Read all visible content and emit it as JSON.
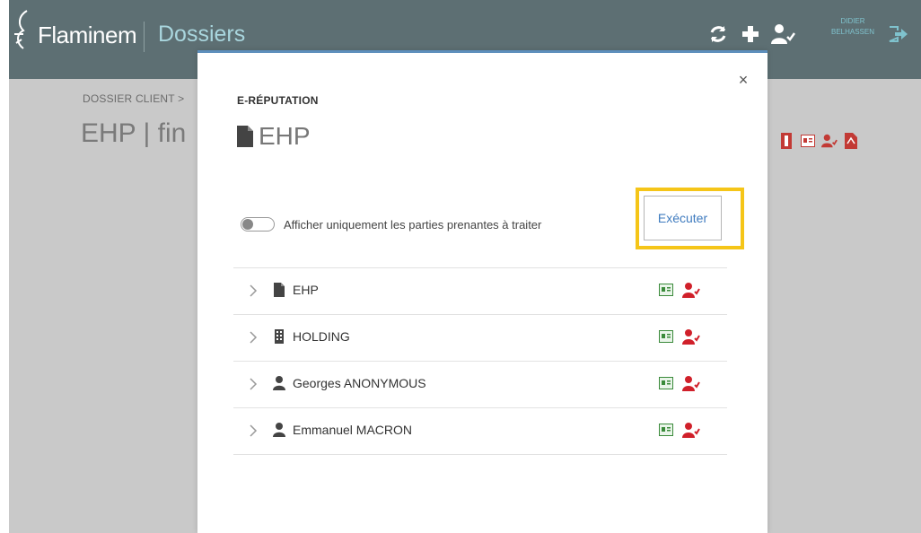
{
  "app": {
    "brand": "Flaminem",
    "module": "Dossiers",
    "user_line1": "DIDIER",
    "user_line2": "BELHASSEN",
    "colors": {
      "topbar": "#5d6f73",
      "accent": "#3f7bbf",
      "red": "#d0202a",
      "green": "#3a8a3a",
      "highlight": "#f5c518"
    }
  },
  "background": {
    "breadcrumb": "DOSSIER CLIENT  >  ",
    "title": "EHP | fin"
  },
  "modal": {
    "kicker": "E-RÉPUTATION",
    "title": "EHP",
    "close": "×",
    "toggle_label": "Afficher uniquement les parties prenantes à traiter",
    "execute": "Exécuter"
  },
  "entities": [
    {
      "label": "EHP",
      "icon": "document-icon"
    },
    {
      "label": "HOLDING",
      "icon": "building-icon"
    },
    {
      "label": "Georges ANONYMOUS",
      "icon": "person-icon"
    },
    {
      "label": "Emmanuel MACRON",
      "icon": "person-icon"
    }
  ]
}
